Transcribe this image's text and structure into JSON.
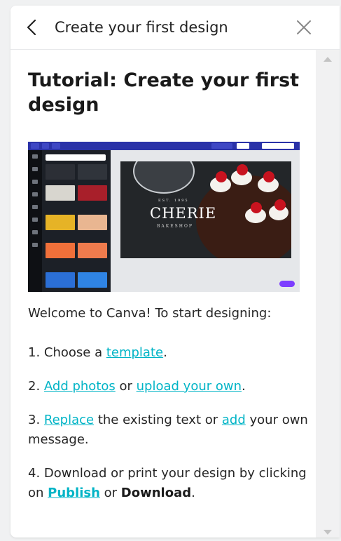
{
  "header": {
    "title": "Create your first design",
    "back_icon": "chevron-left-icon",
    "close_icon": "close-icon"
  },
  "tutorial": {
    "title": "Tutorial: Create your first design",
    "image_text": {
      "brand": "CHERIE",
      "established": "EST. 1995",
      "shop": "BAKESHOP"
    },
    "welcome": "Welcome to Canva! To start designing:",
    "steps": [
      {
        "prefix": "1. Choose a ",
        "link": "template",
        "suffix": "."
      },
      {
        "prefix": "2. ",
        "link1": "Add photos",
        "middle": " or ",
        "link2": "upload your own",
        "suffix": "."
      },
      {
        "prefix": "3. ",
        "link1": "Replace",
        "middle": " the existing text or ",
        "link2": "add",
        "suffix": " your own message."
      },
      {
        "prefix": "4. Download or print your design by clicking on ",
        "link": "Publish",
        "middle": " or ",
        "bold": "Download",
        "suffix": "."
      }
    ]
  },
  "colors": {
    "link": "#00b4c6",
    "canva_purple": "#7d3dff",
    "toolbar_blue": "#2a32a8"
  }
}
